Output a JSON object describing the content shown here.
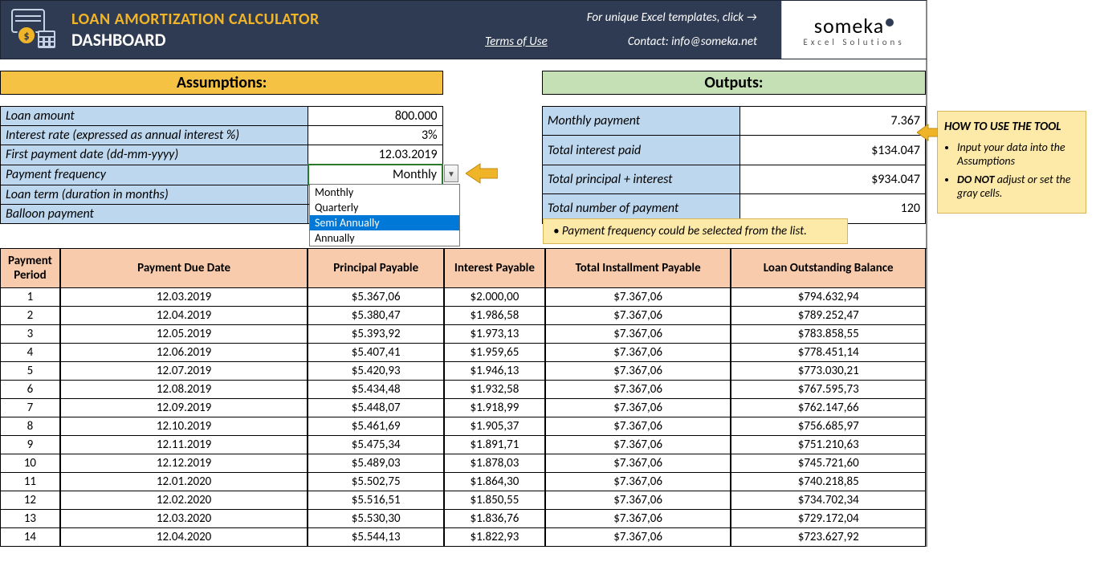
{
  "header": {
    "title": "LOAN AMORTIZATION CALCULATOR",
    "subtitle": "DASHBOARD",
    "click_text": "For unique Excel templates, click →",
    "terms": "Terms of Use",
    "contact": "Contact: info@someka.net",
    "brand": "someka",
    "brand_sub": "Excel Solutions"
  },
  "sections": {
    "assumptions_title": "Assumptions:",
    "outputs_title": "Outputs:"
  },
  "assumptions": {
    "loan_amount_label": "Loan amount",
    "loan_amount_value": "800.000",
    "interest_rate_label": "Interest rate (expressed as annual interest %)",
    "interest_rate_value": "3%",
    "first_payment_label": "First payment date (dd-mm-yyyy)",
    "first_payment_value": "12.03.2019",
    "payment_freq_label": "Payment frequency",
    "payment_freq_value": "Monthly",
    "loan_term_label": "Loan term (duration in months)",
    "loan_term_value": "",
    "balloon_label": "Balloon payment",
    "balloon_value": ""
  },
  "freq_options": [
    "Monthly",
    "Quarterly",
    "Semi Annually",
    "Annually"
  ],
  "freq_selected_index": 2,
  "outputs": {
    "monthly_payment_label": "Monthly payment",
    "monthly_payment_value": "7.367",
    "total_interest_label": "Total interest paid",
    "total_interest_value": "$134.047",
    "total_pi_label": "Total principal + interest",
    "total_pi_value": "$934.047",
    "total_num_label": "Total number of payment",
    "total_num_value": "120"
  },
  "hint": "Payment frequency could be selected from the list.",
  "howto": {
    "title": "HOW TO USE THE TOOL",
    "bullet1": "Input your data into the Assumptions",
    "bullet2a": "DO NOT",
    "bullet2b": " adjust or set the gray cells."
  },
  "amort_headers": {
    "period": "Payment Period",
    "due": "Payment Due Date",
    "principal": "Principal Payable",
    "interest": "Interest Payable",
    "total": "Total Installment Payable",
    "balance": "Loan Outstanding Balance"
  },
  "amort_rows": [
    {
      "p": "1",
      "d": "12.03.2019",
      "pr": "$5.367,06",
      "in": "$2.000,00",
      "t": "$7.367,06",
      "b": "$794.632,94"
    },
    {
      "p": "2",
      "d": "12.04.2019",
      "pr": "$5.380,47",
      "in": "$1.986,58",
      "t": "$7.367,06",
      "b": "$789.252,47"
    },
    {
      "p": "3",
      "d": "12.05.2019",
      "pr": "$5.393,92",
      "in": "$1.973,13",
      "t": "$7.367,06",
      "b": "$783.858,55"
    },
    {
      "p": "4",
      "d": "12.06.2019",
      "pr": "$5.407,41",
      "in": "$1.959,65",
      "t": "$7.367,06",
      "b": "$778.451,14"
    },
    {
      "p": "5",
      "d": "12.07.2019",
      "pr": "$5.420,93",
      "in": "$1.946,13",
      "t": "$7.367,06",
      "b": "$773.030,21"
    },
    {
      "p": "6",
      "d": "12.08.2019",
      "pr": "$5.434,48",
      "in": "$1.932,58",
      "t": "$7.367,06",
      "b": "$767.595,73"
    },
    {
      "p": "7",
      "d": "12.09.2019",
      "pr": "$5.448,07",
      "in": "$1.918,99",
      "t": "$7.367,06",
      "b": "$762.147,66"
    },
    {
      "p": "8",
      "d": "12.10.2019",
      "pr": "$5.461,69",
      "in": "$1.905,37",
      "t": "$7.367,06",
      "b": "$756.685,97"
    },
    {
      "p": "9",
      "d": "12.11.2019",
      "pr": "$5.475,34",
      "in": "$1.891,71",
      "t": "$7.367,06",
      "b": "$751.210,63"
    },
    {
      "p": "10",
      "d": "12.12.2019",
      "pr": "$5.489,03",
      "in": "$1.878,03",
      "t": "$7.367,06",
      "b": "$745.721,60"
    },
    {
      "p": "11",
      "d": "12.01.2020",
      "pr": "$5.502,75",
      "in": "$1.864,30",
      "t": "$7.367,06",
      "b": "$740.218,85"
    },
    {
      "p": "12",
      "d": "12.02.2020",
      "pr": "$5.516,51",
      "in": "$1.850,55",
      "t": "$7.367,06",
      "b": "$734.702,34"
    },
    {
      "p": "13",
      "d": "12.03.2020",
      "pr": "$5.530,30",
      "in": "$1.836,76",
      "t": "$7.367,06",
      "b": "$729.172,04"
    },
    {
      "p": "14",
      "d": "12.04.2020",
      "pr": "$5.544,13",
      "in": "$1.822,93",
      "t": "$7.367,06",
      "b": "$723.627,92"
    }
  ]
}
